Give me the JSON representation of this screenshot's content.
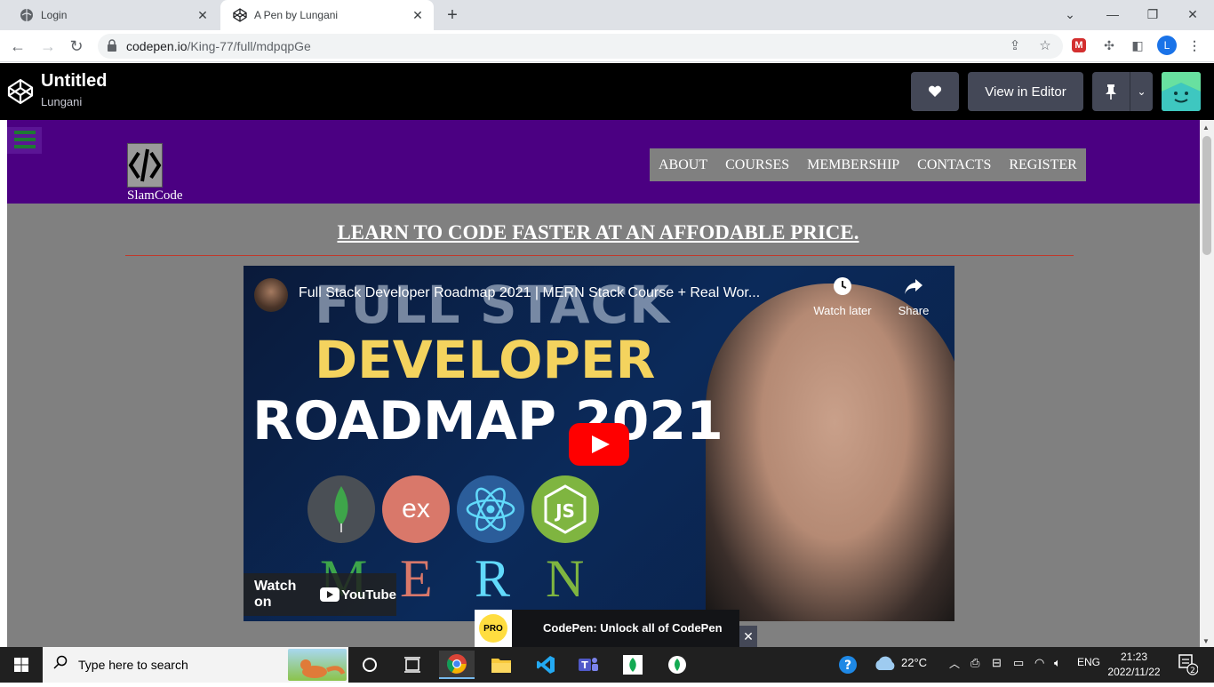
{
  "browser": {
    "tabs": [
      {
        "title": "Login",
        "active": false
      },
      {
        "title": "A Pen by Lungani",
        "active": true
      }
    ],
    "url_host": "codepen.io",
    "url_path": "/King-77/full/mdpqpGe",
    "profile_initial": "L"
  },
  "codepen": {
    "title": "Untitled",
    "author": "Lungani",
    "view_in_editor": "View in Editor"
  },
  "site": {
    "name": "SlamCode",
    "menu": [
      "ABOUT",
      "COURSES",
      "MEMBERSHIP",
      "CONTACTS",
      "REGISTER"
    ],
    "headline": "LEARN TO CODE FASTER AT AN AFFODABLE PRICE."
  },
  "video": {
    "title": "Full Stack Developer Roadmap 2021 | MERN Stack Course + Real Wor...",
    "watch_later": "Watch later",
    "share": "Share",
    "watch_on": "Watch on",
    "youtube": "YouTube",
    "thumb_line1": "FULL STACK",
    "thumb_line2": "DEVELOPER",
    "thumb_line3": "ROADMAP 2021",
    "tech_labels": [
      "ex",
      "JS"
    ],
    "mern_letters": [
      "M",
      "E",
      "R",
      "N"
    ]
  },
  "pro_banner": {
    "badge": "PRO",
    "text": "CodePen: Unlock all of CodePen"
  },
  "taskbar": {
    "search_placeholder": "Type here to search",
    "temperature": "22°C",
    "language": "ENG",
    "time": "21:23",
    "date": "2022/11/22",
    "notifications": "2"
  },
  "colors": {
    "site_nav": "#4b0082",
    "page_bg": "#808080",
    "codepen_header": "#000000",
    "youtube_red": "#ff0000"
  }
}
